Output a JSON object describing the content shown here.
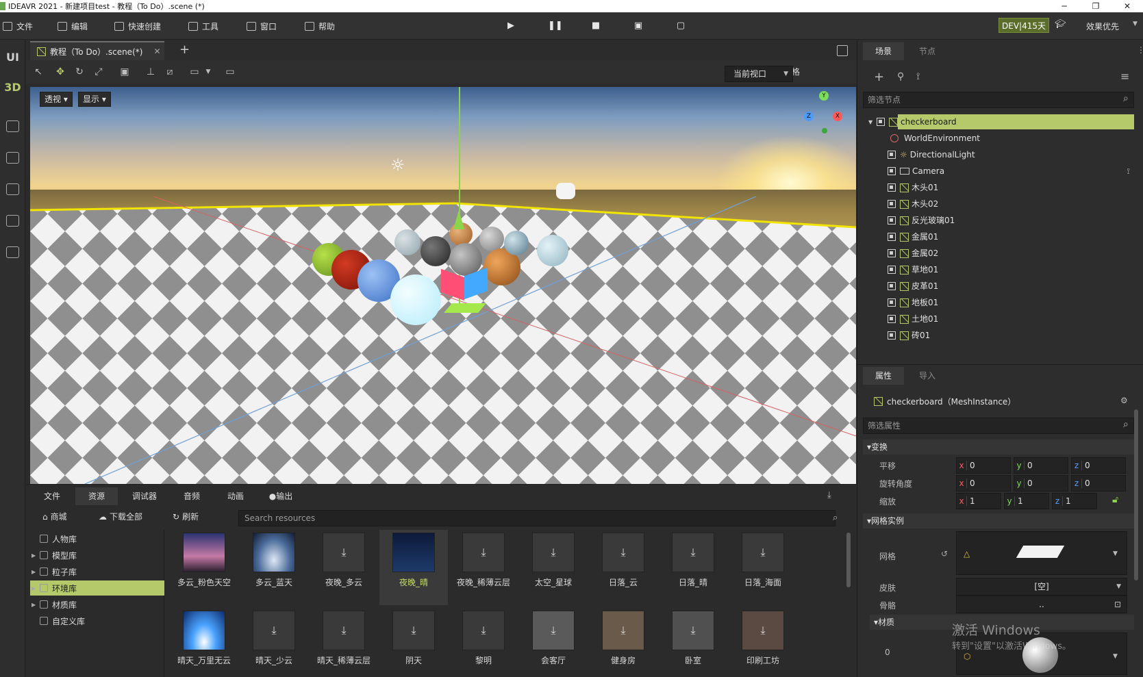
{
  "window": {
    "title": "IDEAVR 2021 - 新建项目test - 教程（To Do）.scene (*)",
    "minimize": "─",
    "restore": "❐",
    "close": "✕"
  },
  "menubar": {
    "items": [
      {
        "label": "文件"
      },
      {
        "label": "编辑"
      },
      {
        "label": "快速创建"
      },
      {
        "label": "工具"
      },
      {
        "label": "窗口"
      },
      {
        "label": "帮助"
      }
    ],
    "dev_badge": "DEV|415天",
    "quality": "效果优先"
  },
  "leftbar": {
    "ui_label": "UI",
    "threed_label": "3D"
  },
  "scene_tab": {
    "label": "教程（To Do）.scene(*)",
    "close": "✕",
    "add": "+"
  },
  "viewport_toolbar": {
    "view_select": "当前视口",
    "grid_label": "网格"
  },
  "viewport": {
    "perspective": "透视",
    "display": "显示",
    "gizmo_y": "Y",
    "gizmo_x": "X",
    "gizmo_z": "Z"
  },
  "bottom_tabs": [
    {
      "label": "文件"
    },
    {
      "label": "资源"
    },
    {
      "label": "调试器"
    },
    {
      "label": "音频"
    },
    {
      "label": "动画"
    },
    {
      "label": "●输出"
    }
  ],
  "resources": {
    "store": "商城",
    "download_all": "下载全部",
    "refresh": "刷新",
    "search_placeholder": "Search resources",
    "tree": [
      {
        "label": "人物库"
      },
      {
        "label": "模型库"
      },
      {
        "label": "粒子库"
      },
      {
        "label": "环境库"
      },
      {
        "label": "材质库"
      },
      {
        "label": "自定义库"
      }
    ],
    "items": [
      {
        "label": "多云_粉色天空"
      },
      {
        "label": "多云_蓝天"
      },
      {
        "label": "夜晚_多云"
      },
      {
        "label": "夜晚_晴"
      },
      {
        "label": "夜晚_稀薄云层"
      },
      {
        "label": "太空_星球"
      },
      {
        "label": "日落_云"
      },
      {
        "label": "日落_晴"
      },
      {
        "label": "日落_海面"
      },
      {
        "label": "晴天_万里无云"
      },
      {
        "label": "晴天_少云"
      },
      {
        "label": "晴天_稀薄云层"
      },
      {
        "label": "阴天"
      },
      {
        "label": "黎明"
      },
      {
        "label": "会客厅"
      },
      {
        "label": "健身房"
      },
      {
        "label": "卧室"
      },
      {
        "label": "印刷工坊"
      }
    ]
  },
  "scene_panel": {
    "tab_scene": "场景",
    "tab_node": "节点",
    "filter_placeholder": "筛选节点",
    "nodes": [
      {
        "label": "checkerboard"
      },
      {
        "label": "WorldEnvironment"
      },
      {
        "label": "DirectionalLight"
      },
      {
        "label": "Camera"
      },
      {
        "label": "木头01"
      },
      {
        "label": "木头02"
      },
      {
        "label": "反光玻璃01"
      },
      {
        "label": "金属01"
      },
      {
        "label": "金属02"
      },
      {
        "label": "草地01"
      },
      {
        "label": "皮革01"
      },
      {
        "label": "地板01"
      },
      {
        "label": "土地01"
      },
      {
        "label": "砖01"
      }
    ]
  },
  "properties": {
    "tab_props": "属性",
    "tab_import": "导入",
    "object_name": "checkerboard（MeshInstance）",
    "filter_placeholder": "筛选属性",
    "section_transform": "▾变换",
    "translate": "平移",
    "rotate": "旋转角度",
    "scale": "缩放",
    "axis_x": "x",
    "axis_y": "y",
    "axis_z": "z",
    "translate_vals": [
      "0",
      "0",
      "0"
    ],
    "rotate_vals": [
      "0",
      "0",
      "0"
    ],
    "scale_vals": [
      "1",
      "1",
      "1"
    ],
    "section_mesh": "▾网格实例",
    "mesh": "网格",
    "skin": "皮肤",
    "skin_value": "[空]",
    "skeleton": "骨骼",
    "skeleton_value": "..",
    "section_material": "▾材质",
    "material_index": "0"
  },
  "watermark": {
    "line1": "激活 Windows",
    "line2": "转到\"设置\"以激活Windows。"
  },
  "colors": {
    "accent": "#b5c96a",
    "panel": "#2d2d2d",
    "dark": "#232323"
  }
}
